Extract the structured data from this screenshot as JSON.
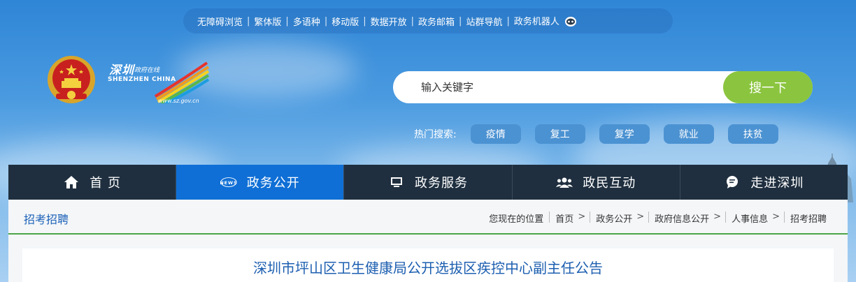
{
  "top_links": [
    "无障碍浏览",
    "繁体版",
    "多语种",
    "移动版",
    "数据开放",
    "政务邮箱",
    "站群导航",
    "政务机器人"
  ],
  "logo": {
    "cn_name": "深圳",
    "sub": "政府在线",
    "en": "SHENZHEN CHINA",
    "url": "www.sz.gov.cn"
  },
  "search": {
    "placeholder": "输入关键字",
    "button": "搜一下"
  },
  "hot_search": {
    "label": "热门搜索:",
    "tags": [
      "疫情",
      "复工",
      "复学",
      "就业",
      "扶贫"
    ]
  },
  "nav": [
    {
      "label": "首 页",
      "icon": "home-icon",
      "active": false
    },
    {
      "label": "政务公开",
      "icon": "news-icon",
      "active": true
    },
    {
      "label": "政务服务",
      "icon": "monitor-icon",
      "active": false
    },
    {
      "label": "政民互动",
      "icon": "people-icon",
      "active": false
    },
    {
      "label": "走进深圳",
      "icon": "chat-icon",
      "active": false
    }
  ],
  "section_title": "招考招聘",
  "breadcrumb": {
    "label": "您现在的位置",
    "items": [
      "首页",
      "政务公开",
      "政府信息公开",
      "人事信息",
      "招考招聘"
    ]
  },
  "article_title": "深圳市坪山区卫生健康局公开选拔区疾控中心副主任公告",
  "colors": {
    "nav_bg": "#1f2f3f",
    "nav_active": "#0f6fd6",
    "search_button": "#8bc53f",
    "accent_green": "#4ca546",
    "title_blue": "#1d5fb0"
  }
}
